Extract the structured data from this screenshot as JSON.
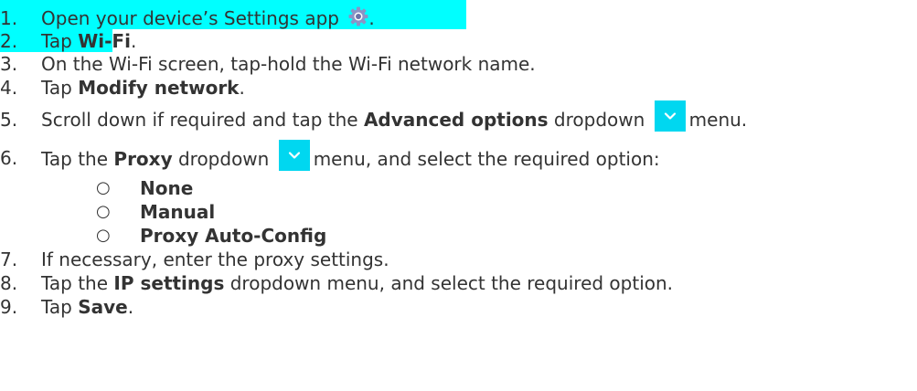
{
  "colors": {
    "highlight": "#00ffff",
    "chevron_box": "#00d7f0",
    "text": "#333333"
  },
  "steps": [
    {
      "num": "1.",
      "parts": [
        "Open your device’s Settings app ",
        "."
      ],
      "icon": "settings-gear-icon"
    },
    {
      "num": "2.",
      "pre": "Tap ",
      "bold": "Wi-Fi",
      "post": "."
    },
    {
      "num": "3.",
      "text": "On the Wi-Fi screen, tap-hold the Wi-Fi network name."
    },
    {
      "num": "4.",
      "pre": "Tap ",
      "bold": "Modify network",
      "post": "."
    },
    {
      "num": "5.",
      "pre": "Scroll down if required and tap the ",
      "bold": "Advanced options",
      "mid": " dropdown ",
      "post": "menu.",
      "icon": "chevron-down-icon"
    },
    {
      "num": "6.",
      "pre": "Tap the ",
      "bold": "Proxy",
      "mid": " dropdown ",
      "post": "menu, and select the required option:",
      "icon": "chevron-down-icon"
    },
    {
      "num": "7.",
      "text": "If necessary, enter the proxy settings."
    },
    {
      "num": "8.",
      "pre": "Tap the ",
      "bold": "IP settings",
      "post": " dropdown menu, and select the required option."
    },
    {
      "num": "9.",
      "pre": "Tap ",
      "bold": "Save",
      "post": "."
    }
  ],
  "proxy_options": [
    {
      "bullet": "○",
      "label": "None"
    },
    {
      "bullet": "○",
      "label": "Manual"
    },
    {
      "bullet": "○",
      "label": "Proxy Auto-Config"
    }
  ]
}
